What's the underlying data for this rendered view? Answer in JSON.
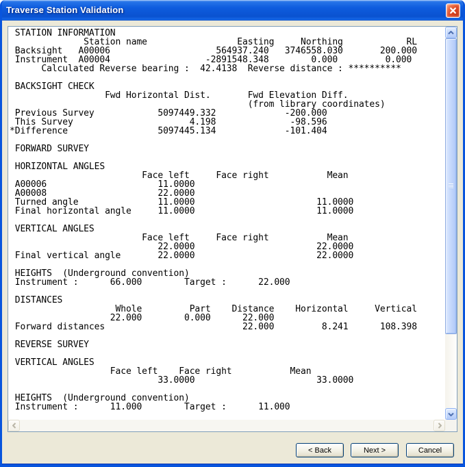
{
  "window": {
    "title": "Traverse Station Validation"
  },
  "report": {
    "lines": [
      " STATION INFORMATION",
      "              Station name                 Easting     Northing            RL",
      " Backsight   A00006                    564937.240   3746558.030       200.000",
      " Instrument  A00004                  -2891548.348        0.000         0.000",
      "      Calculated Reverse bearing :  42.4138  Reverse distance : **********",
      "",
      " BACKSIGHT CHECK",
      "                  Fwd Horizontal Dist.       Fwd Elevation Diff.",
      "                                             (from library coordinates)",
      " Previous Survey            5097449.332             -200.000",
      " This Survey                      4.198              -98.596",
      "*Difference                 5097445.134             -101.404",
      "",
      " FORWARD SURVEY",
      "",
      " HORIZONTAL ANGLES",
      "                         Face left     Face right           Mean",
      " A00006                     11.0000",
      " A00008                     22.0000",
      " Turned angle               11.0000                       11.0000",
      " Final horizontal angle     11.0000                       11.0000",
      "",
      " VERTICAL ANGLES",
      "                         Face left     Face right           Mean",
      "                            22.0000                       22.0000",
      " Final vertical angle       22.0000                       22.0000",
      "",
      " HEIGHTS  (Underground convention)",
      " Instrument :      66.000        Target :      22.000",
      "",
      " DISTANCES",
      "                    Whole         Part    Distance    Horizontal     Vertical",
      "                   22.000        0.000      22.000",
      " Forward distances                          22.000         8.241      108.398",
      "",
      " REVERSE SURVEY",
      "",
      " VERTICAL ANGLES",
      "                   Face left    Face right           Mean",
      "                            33.0000                       33.0000",
      "",
      " HEIGHTS  (Underground convention)",
      " Instrument :      11.000        Target :      11.000"
    ]
  },
  "buttons": {
    "back": "< Back",
    "next": "Next >",
    "cancel": "Cancel"
  },
  "colors": {
    "titlebar_blue": "#0E5CDE",
    "frame_blue": "#0855DD",
    "client_bg": "#ECE9D8",
    "close_red": "#D84220",
    "scroll_thumb_blue": "#C6D9FC",
    "textbox_border": "#7F9DB9"
  }
}
